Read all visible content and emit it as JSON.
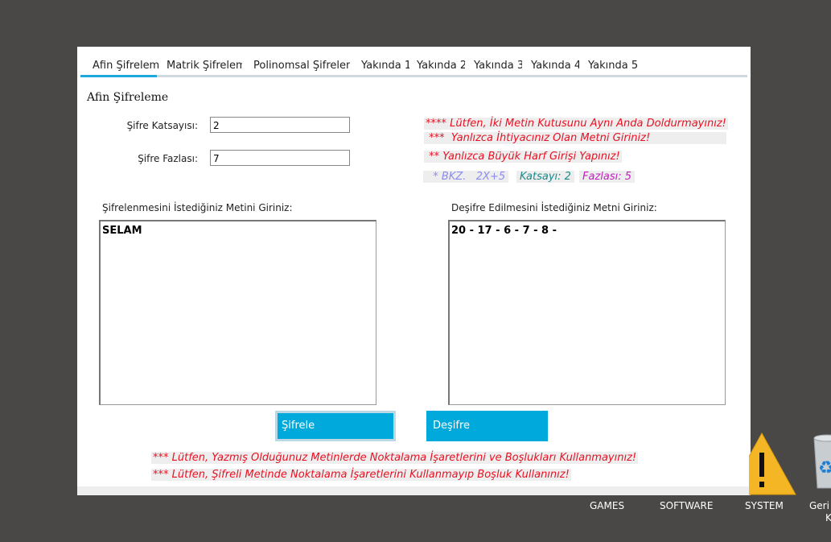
{
  "tabs": [
    "Afin Şifreleme",
    "Matrik Şifreleme",
    "Polinomsal Şifreleme",
    "Yakında 1",
    "Yakında 2",
    "Yakında 3",
    "Yakında 4",
    "Yakında 5!"
  ],
  "section_title": "Afin Şifreleme",
  "form": {
    "coefficient_label": "Şifre Katsayısı:",
    "coefficient_value": "2",
    "excess_label": "Şifre Fazlası:",
    "excess_value": "7"
  },
  "warnings": {
    "line1": "**** Lütfen, İki Metin Kutusunu Aynı Anda Doldurmayınız!",
    "line2": " ***  Yanlızca İhtiyacınız Olan Metni Giriniz!",
    "line3": " ** Yanlızca Büyük Harf Girişi Yapınız!"
  },
  "hint": {
    "bkz": "  * BKZ.   2X+5",
    "katsayi": "Katsayı: 2",
    "fazlasi": "Fazlası: 5"
  },
  "encrypt_prompt": "Şifrelenmesini İstediğiniz Metini Giriniz:",
  "decrypt_prompt": "Deşifre Edilmesini İstediğiniz Metni Giriniz:",
  "encrypt_text": "SELAM",
  "decrypt_text": "20 - 17 - 6 - 7 - 8 -",
  "buttons": {
    "encrypt": "Şifrele",
    "decrypt": "Deşifre"
  },
  "footer_warnings": {
    "line1": "*** Lütfen, Yazmış Olduğunuz Metinlerde Noktalama İşaretlerini ve Boşlukları Kullanmayınız!",
    "line2": "*** Lütfen, Şifreli Metinde Noktalama İşaretlerini Kullanmayıp Boşluk Kullanınız!"
  },
  "desktop": {
    "games": "GAMES",
    "software": "SOFTWARE",
    "system": "SYSTEM",
    "recycle": "Geri D",
    "recycle2": "K"
  },
  "colors": {
    "accent": "#00a9dc",
    "warning": "#e81123",
    "hint_bkz": "#8a8cf0",
    "hint_katsayi": "#1a8a8a",
    "hint_fazlasi": "#c020c0"
  }
}
